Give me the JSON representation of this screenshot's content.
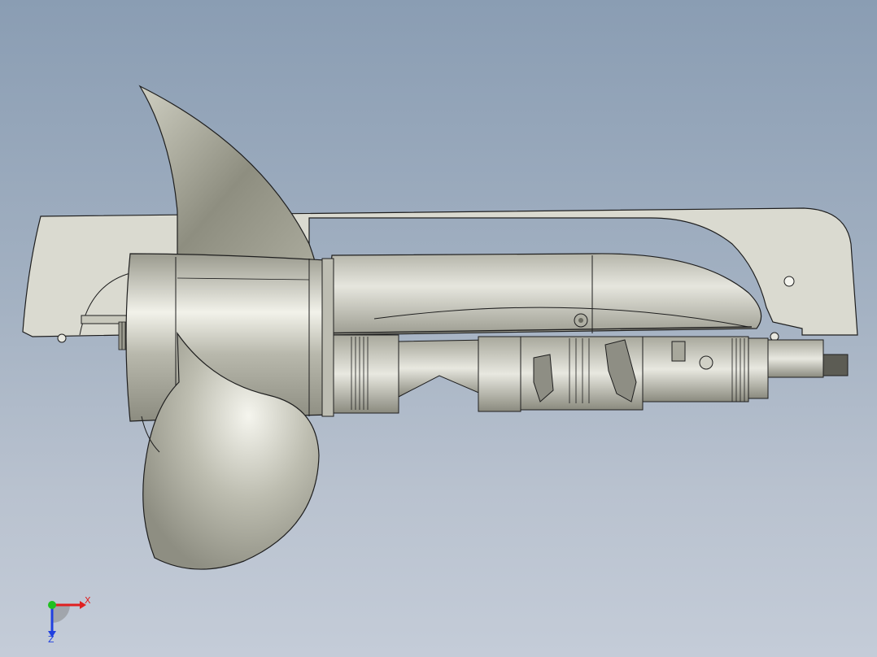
{
  "viewport": {
    "background_top": "#8a9db3",
    "background_bottom": "#c4ccd8"
  },
  "model": {
    "part_color": "#d9d9cf",
    "metal_color": "#c8c8bc",
    "edge_color": "#1e1e1e"
  },
  "triad": {
    "x_label": "X",
    "z_label": "Z",
    "x_color": "#e02020",
    "y_color": "#20c020",
    "z_color": "#2040e0"
  }
}
